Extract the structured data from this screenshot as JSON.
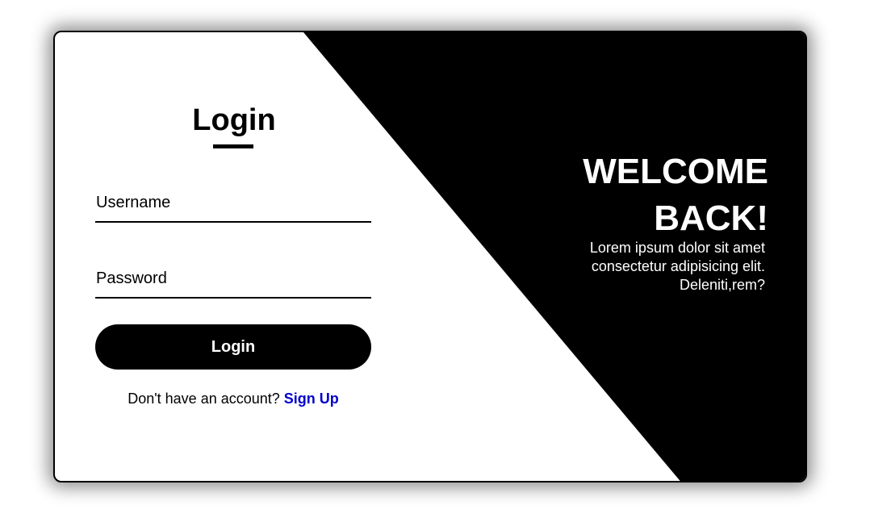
{
  "login": {
    "title": "Login",
    "username_placeholder": "Username",
    "password_placeholder": "Password",
    "button_label": "Login",
    "signup_prompt": "Don't have an account?",
    "signup_link": "Sign Up"
  },
  "welcome": {
    "line1": "WELCOME",
    "line2": "BACK!",
    "text": "Lorem ipsum dolor sit amet consectetur adipisicing elit. Deleniti,rem?"
  },
  "colors": {
    "primary": "#000000",
    "background": "#ffffff",
    "link": "#0000cc"
  }
}
